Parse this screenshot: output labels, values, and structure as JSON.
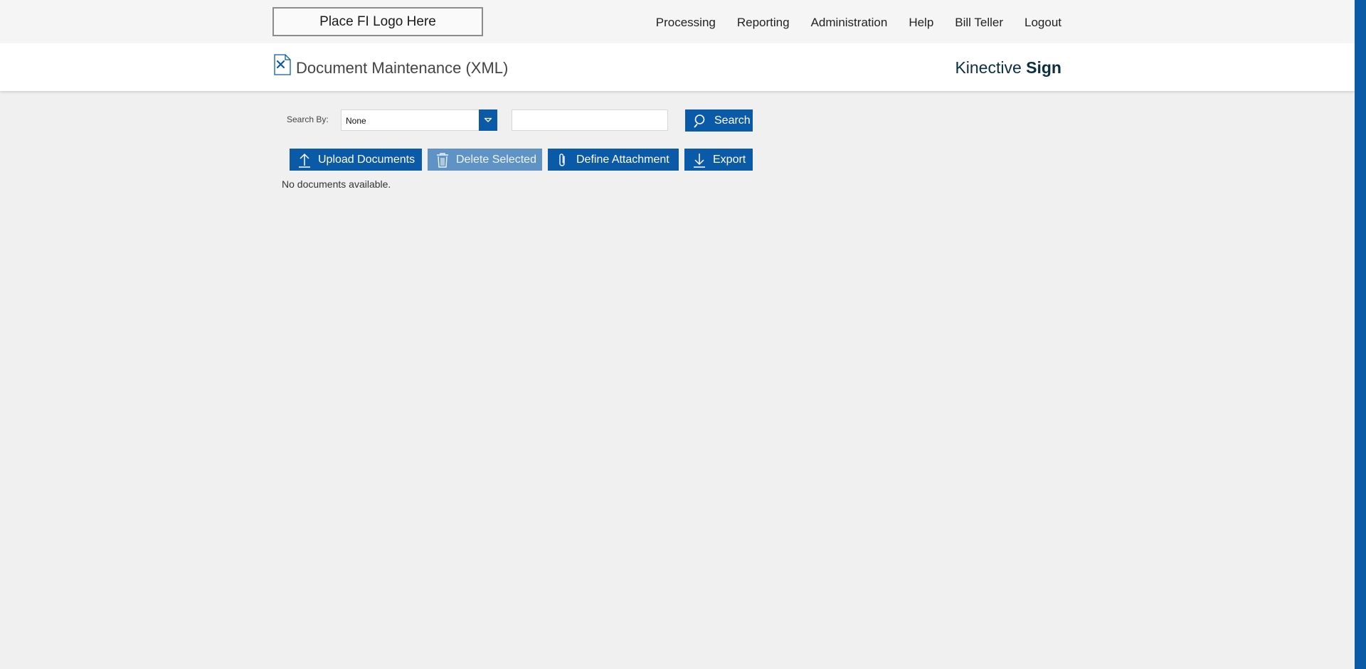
{
  "header": {
    "logo_text": "Place FI Logo Here",
    "nav": [
      {
        "label": "Processing"
      },
      {
        "label": "Reporting"
      },
      {
        "label": "Administration"
      },
      {
        "label": "Help"
      },
      {
        "label": "Bill Teller"
      },
      {
        "label": "Logout"
      }
    ]
  },
  "titlebar": {
    "title": "Document Maintenance (XML)",
    "icon": "document-xml-icon",
    "brand_regular": "Kinective",
    "brand_bold": "Sign"
  },
  "search": {
    "label": "Search By:",
    "selected": "None",
    "input_value": "",
    "button_label": "Search"
  },
  "toolbar": {
    "upload_label": "Upload Documents",
    "delete_label": "Delete Selected",
    "define_label": "Define Attachment",
    "export_label": "Export"
  },
  "content": {
    "empty_message": "No documents available."
  },
  "colors": {
    "accent": "#0a5aa8",
    "disabled": "#5f93c6",
    "background": "#f0f0f0"
  }
}
